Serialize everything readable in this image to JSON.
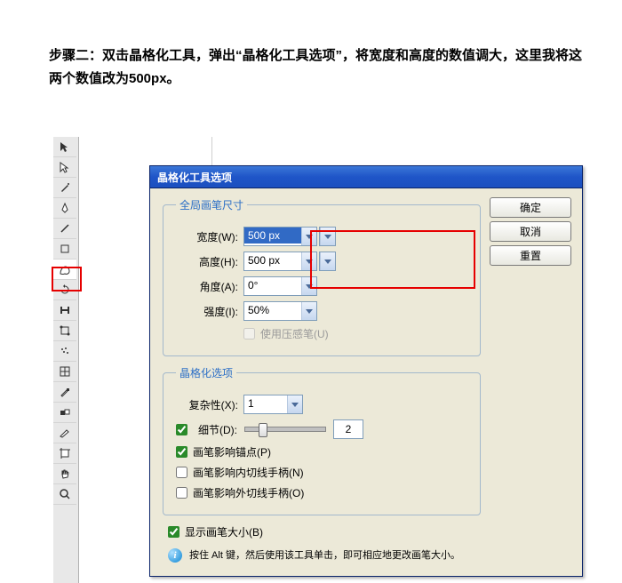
{
  "instruction": "步骤二：双击晶格化工具，弹出“晶格化工具选项”，将宽度和高度的数值调大，这里我将这两个数值改为500px。",
  "dialog": {
    "title": "晶格化工具选项",
    "buttons": {
      "ok": "确定",
      "cancel": "取消",
      "reset": "重置"
    },
    "brush_group": {
      "legend": "全局画笔尺寸",
      "width_label": "宽度(W):",
      "width_value": "500 px",
      "height_label": "高度(H):",
      "height_value": "500 px",
      "angle_label": "角度(A):",
      "angle_value": "0°",
      "intensity_label": "强度(I):",
      "intensity_value": "50%",
      "use_pressure": "使用压感笔(U)"
    },
    "opts_group": {
      "legend": "晶格化选项",
      "complexity_label": "复杂性(X):",
      "complexity_value": "1",
      "detail_label": "细节(D):",
      "detail_value": "2",
      "affect_anchor": "画笔影响锚点(P)",
      "affect_in": "画笔影响内切线手柄(N)",
      "affect_out": "画笔影响外切线手柄(O)"
    },
    "show_brush": "显示画笔大小(B)",
    "tip": "按住 Alt 键，然后使用该工具单击，即可相应地更改画笔大小。"
  }
}
